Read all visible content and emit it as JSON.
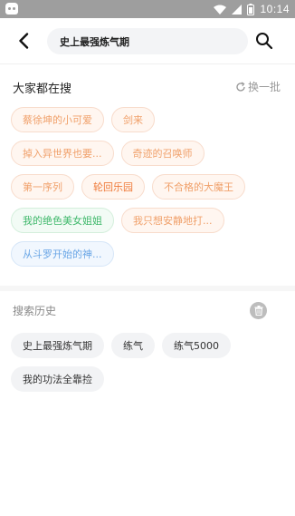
{
  "status_bar": {
    "time": "10:14",
    "icons": [
      "android-app-icon",
      "wifi-icon",
      "cellular-signal-icon",
      "battery-icon"
    ]
  },
  "header": {
    "back_icon": "back-arrow-icon",
    "search_value": "史上最强炼气期",
    "search_icon": "search-icon"
  },
  "hot": {
    "title": "大家都在搜",
    "refresh_label": "换一批",
    "refresh_icon": "refresh-icon",
    "rows": [
      [
        {
          "label": "蔡徐坤的小可爱",
          "style": "orange"
        },
        {
          "label": "剑来",
          "style": "orange"
        }
      ],
      [
        {
          "label": "掉入异世界也要...",
          "style": "orange"
        },
        {
          "label": "奇迹的召唤师",
          "style": "orange"
        }
      ],
      [
        {
          "label": "第一序列",
          "style": "orange"
        },
        {
          "label": "轮回乐园",
          "style": "orange strong"
        },
        {
          "label": "不合格的大魔王",
          "style": "orange"
        }
      ],
      [
        {
          "label": "我的绝色美女姐姐",
          "style": "green"
        },
        {
          "label": "我只想安静地打...",
          "style": "orange"
        }
      ],
      [
        {
          "label": "从斗罗开始的神...",
          "style": "blue"
        }
      ]
    ],
    "colors": {
      "orange": "#f0a06a",
      "orange_strong": "#ef7a3a",
      "green": "#3fb86b",
      "blue": "#6aa6e6"
    }
  },
  "history": {
    "title": "搜索历史",
    "clear_icon": "trash-icon",
    "rows": [
      [
        "史上最强炼气期",
        "练气",
        "练气5000"
      ],
      [
        "我的功法全靠捡"
      ]
    ]
  }
}
